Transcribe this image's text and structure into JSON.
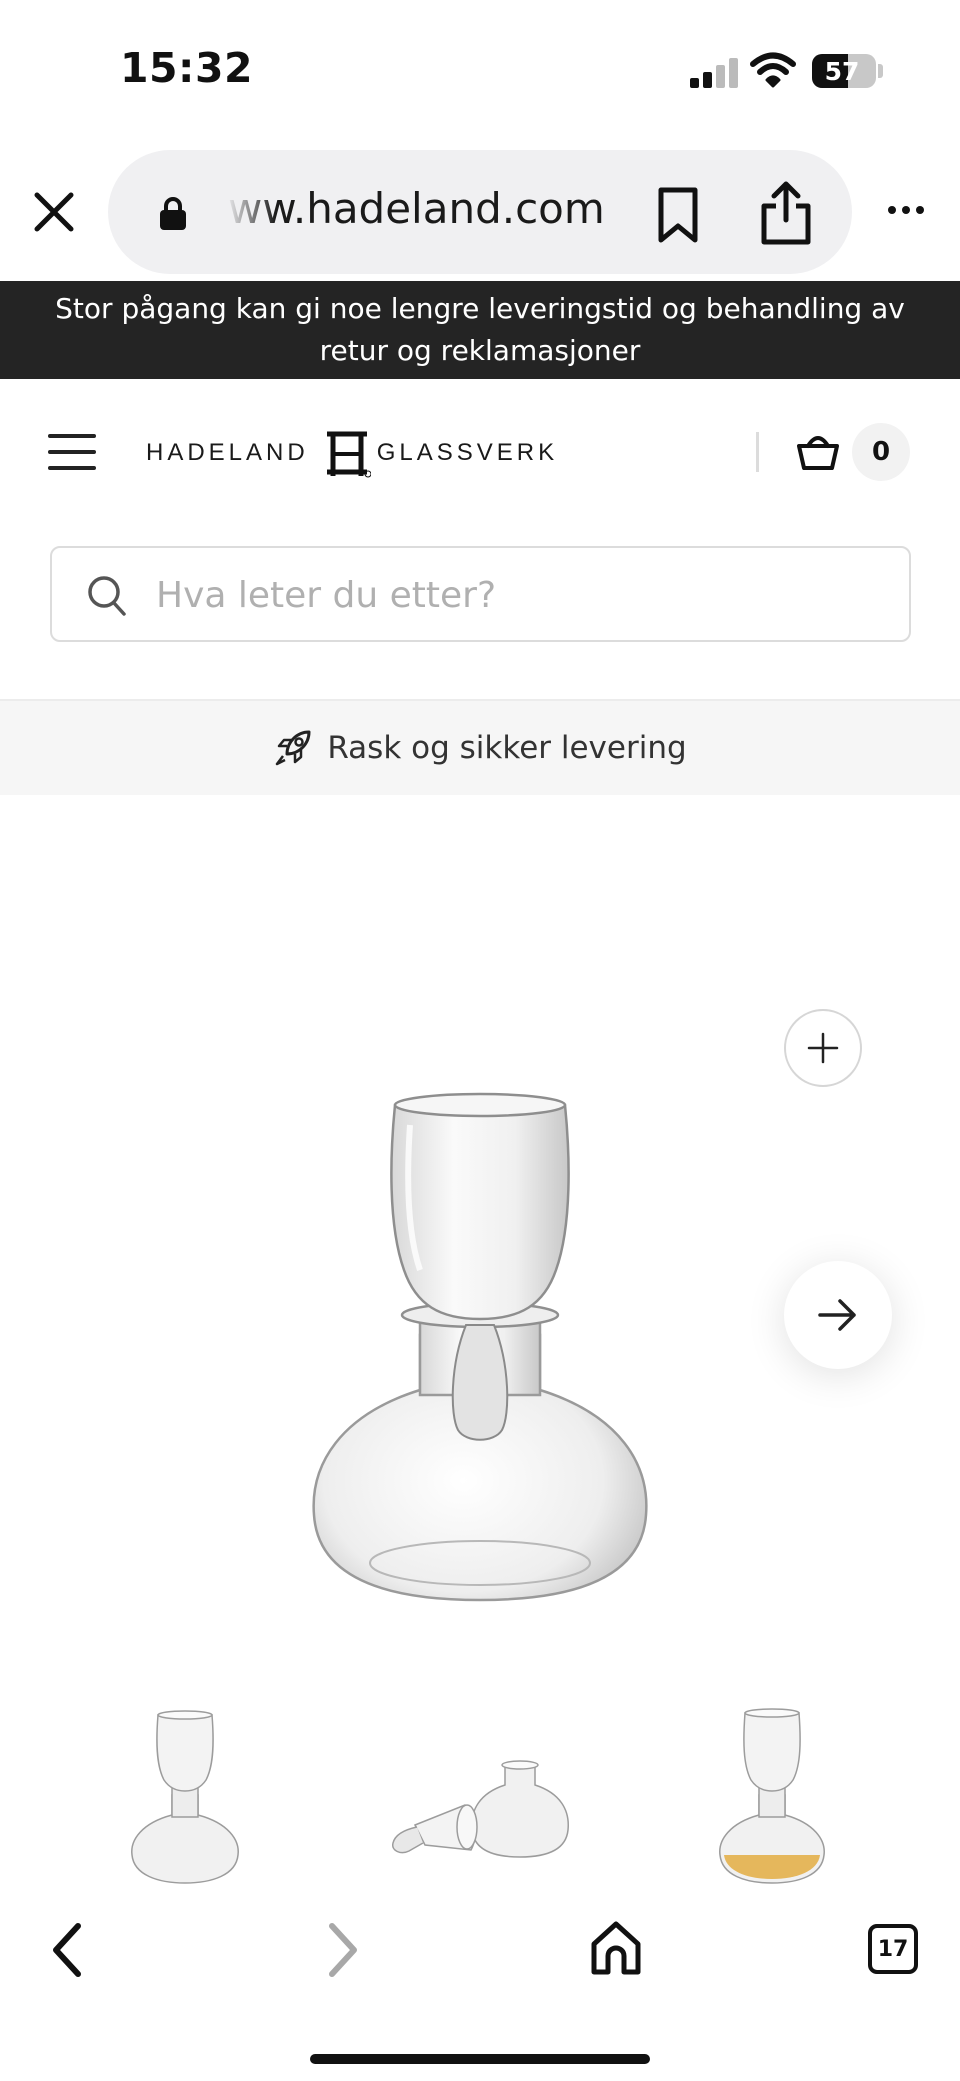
{
  "status_bar": {
    "time": "15:32",
    "battery_level": "57"
  },
  "browser": {
    "url": "ww.hadeland.com",
    "open_tabs_count": "17"
  },
  "announcement": {
    "line1": "Stor pågang kan gi noe lengre leveringstid og behandling av",
    "line2": "retur og reklamasjoner"
  },
  "header": {
    "logo_left": "HADELAND",
    "logo_right": "GLASSVERK",
    "cart_count": "0"
  },
  "search": {
    "placeholder": "Hva leter du etter?"
  },
  "delivery": {
    "label": "Rask og sikker levering"
  },
  "gallery": {
    "thumbnail_count": 3,
    "selected_thumbnail_index": 0
  },
  "colors": {
    "announcement_bg": "#242424",
    "delivery_bg": "#f6f6f6",
    "amber_liquid": "#e3b04b"
  }
}
